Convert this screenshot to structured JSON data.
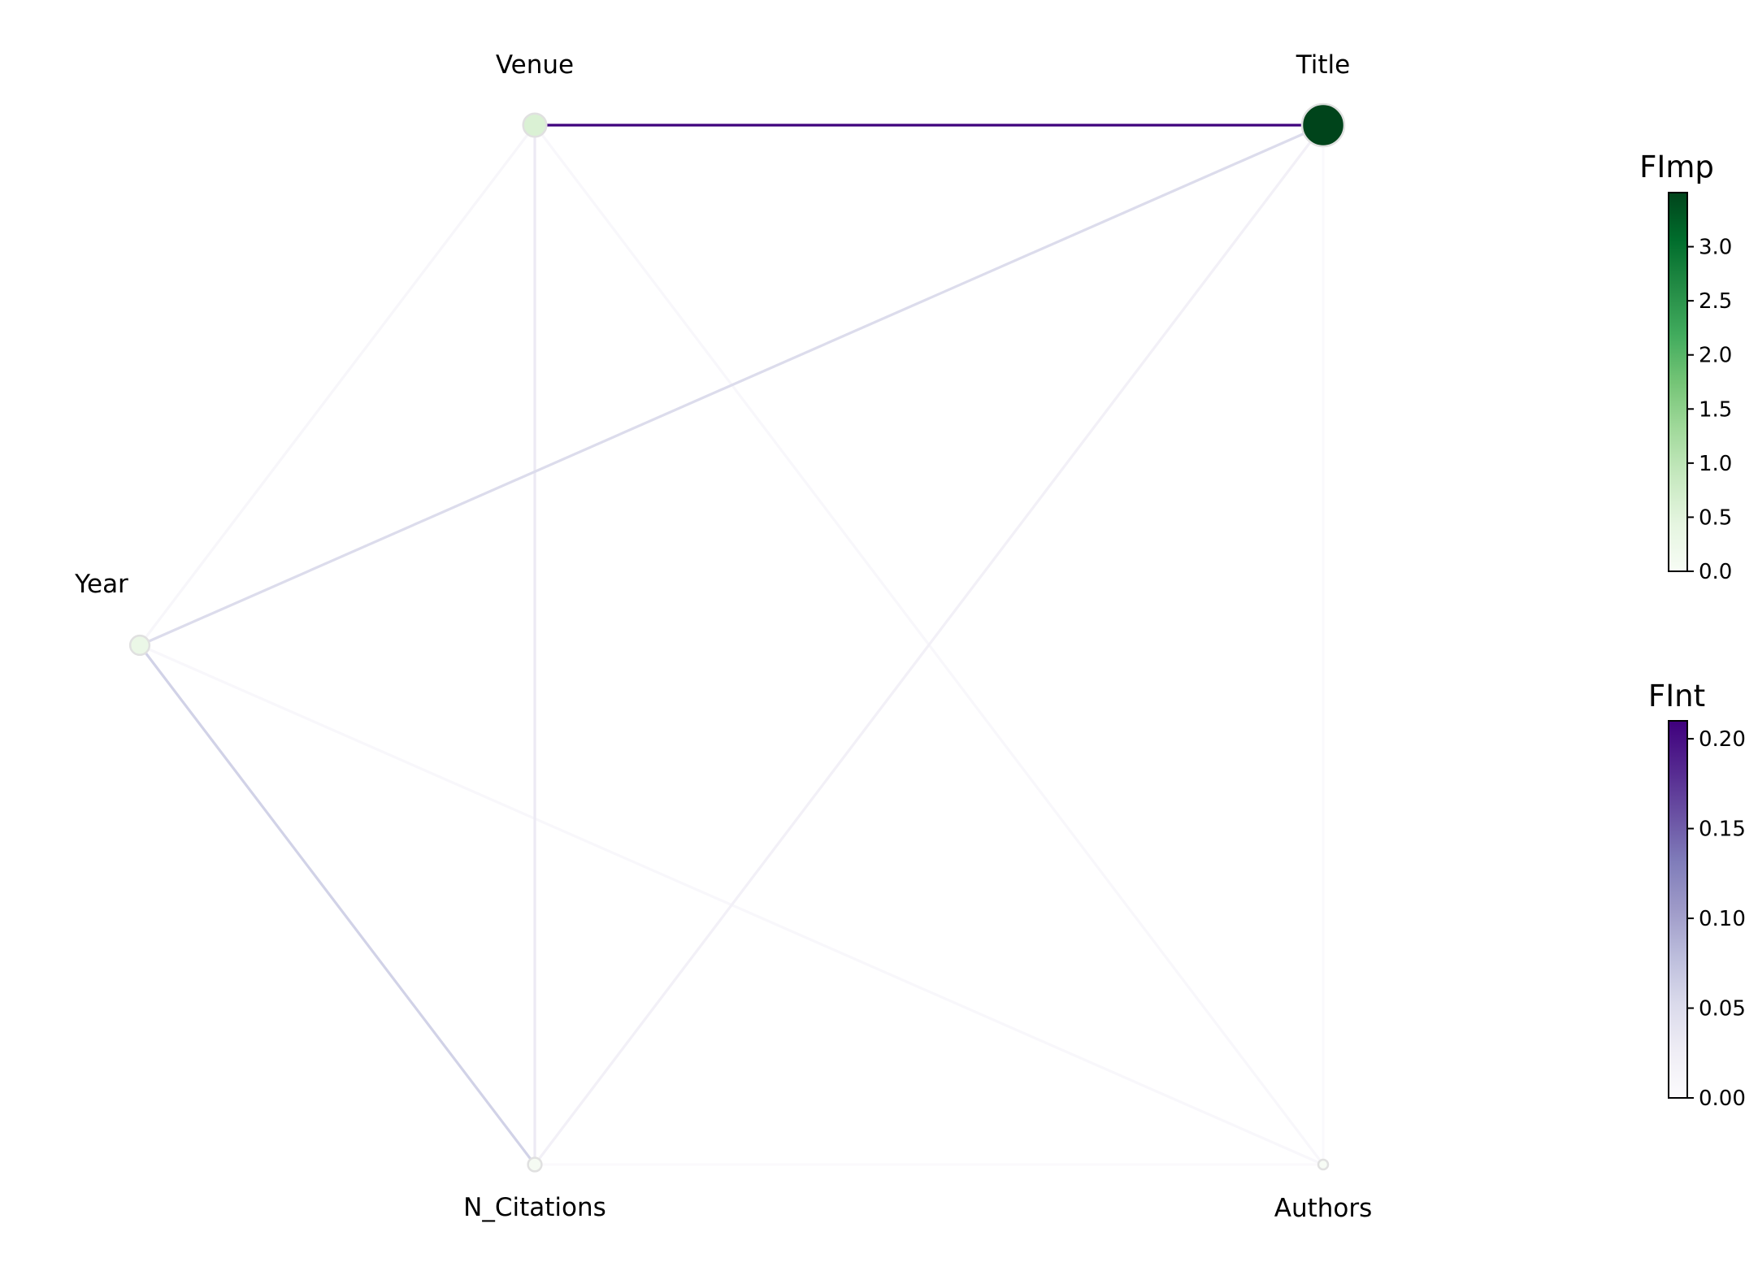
{
  "nodes": [
    {
      "id": "venue",
      "label": "Venue",
      "importance": 0.6
    },
    {
      "id": "title",
      "label": "Title",
      "importance": 3.5
    },
    {
      "id": "year",
      "label": "Year",
      "importance": 0.3
    },
    {
      "id": "n_citations",
      "label": "N_Citations",
      "importance": 0.05
    },
    {
      "id": "authors",
      "label": "Authors",
      "importance": 0.0
    }
  ],
  "edges": [
    {
      "source": "venue",
      "target": "title",
      "interaction": 0.21
    },
    {
      "source": "year",
      "target": "title",
      "interaction": 0.05
    },
    {
      "source": "year",
      "target": "n_citations",
      "interaction": 0.06
    },
    {
      "source": "venue",
      "target": "n_citations",
      "interaction": 0.03
    },
    {
      "source": "n_citations",
      "target": "title",
      "interaction": 0.02
    },
    {
      "source": "venue",
      "target": "year",
      "interaction": 0.01
    },
    {
      "source": "venue",
      "target": "authors",
      "interaction": 0.008
    },
    {
      "source": "year",
      "target": "authors",
      "interaction": 0.008
    },
    {
      "source": "title",
      "target": "authors",
      "interaction": 0.004
    },
    {
      "source": "n_citations",
      "target": "authors",
      "interaction": 0.003
    }
  ],
  "colorbars": {
    "importance": {
      "title": "FImp",
      "min": 0.0,
      "max": 3.5,
      "ticks": [
        "0.0",
        "0.5",
        "1.0",
        "1.5",
        "2.0",
        "2.5",
        "3.0"
      ],
      "colors": [
        "#f7fcf5",
        "#e5f5e0",
        "#c7e9c0",
        "#a1d99b",
        "#74c476",
        "#41ab5d",
        "#238b45",
        "#006d2c",
        "#00441b"
      ]
    },
    "interaction": {
      "title": "FInt",
      "min": 0.0,
      "max": 0.21,
      "ticks": [
        "0.00",
        "0.05",
        "0.10",
        "0.15",
        "0.20"
      ],
      "colors": [
        "#fcfbfd",
        "#efedf5",
        "#dadaeb",
        "#bcbddc",
        "#9e9ac8",
        "#807dba",
        "#6a51a3",
        "#54278f",
        "#3f007d"
      ]
    }
  }
}
